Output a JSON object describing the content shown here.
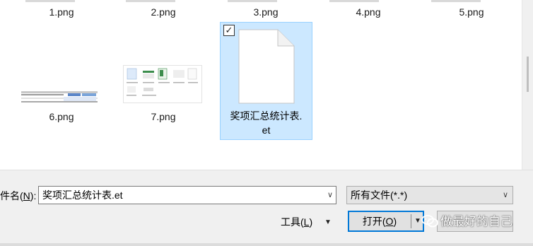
{
  "files": {
    "row1": [
      {
        "name": "1.png"
      },
      {
        "name": "2.png"
      },
      {
        "name": "3.png"
      },
      {
        "name": "4.png"
      },
      {
        "name": "5.png"
      }
    ],
    "row2": [
      {
        "name": "6.png"
      },
      {
        "name": "7.png"
      }
    ],
    "selected": {
      "name_line1": "奖项汇总统计表.",
      "name_line2": "et",
      "checkbox": "✓"
    }
  },
  "bottom": {
    "filename_label_text": "件名(",
    "filename_label_key": "N",
    "filename_label_end": "):",
    "filename_value": "奖项汇总统计表.et",
    "filetype_value": "所有文件(*.*)",
    "tools_text": "工具(",
    "tools_key": "L",
    "tools_end": ")",
    "open_text": "打开(",
    "open_key": "O",
    "open_end": ")",
    "dropdown_glyph": "▼",
    "small_dropdown_glyph": "∨"
  },
  "watermark": {
    "text": "做最好的自己"
  },
  "colors": {
    "selection_bg": "#cce8ff",
    "selection_border": "#99d1ff",
    "accent": "#0078d7",
    "panel": "#f0f0f0"
  }
}
